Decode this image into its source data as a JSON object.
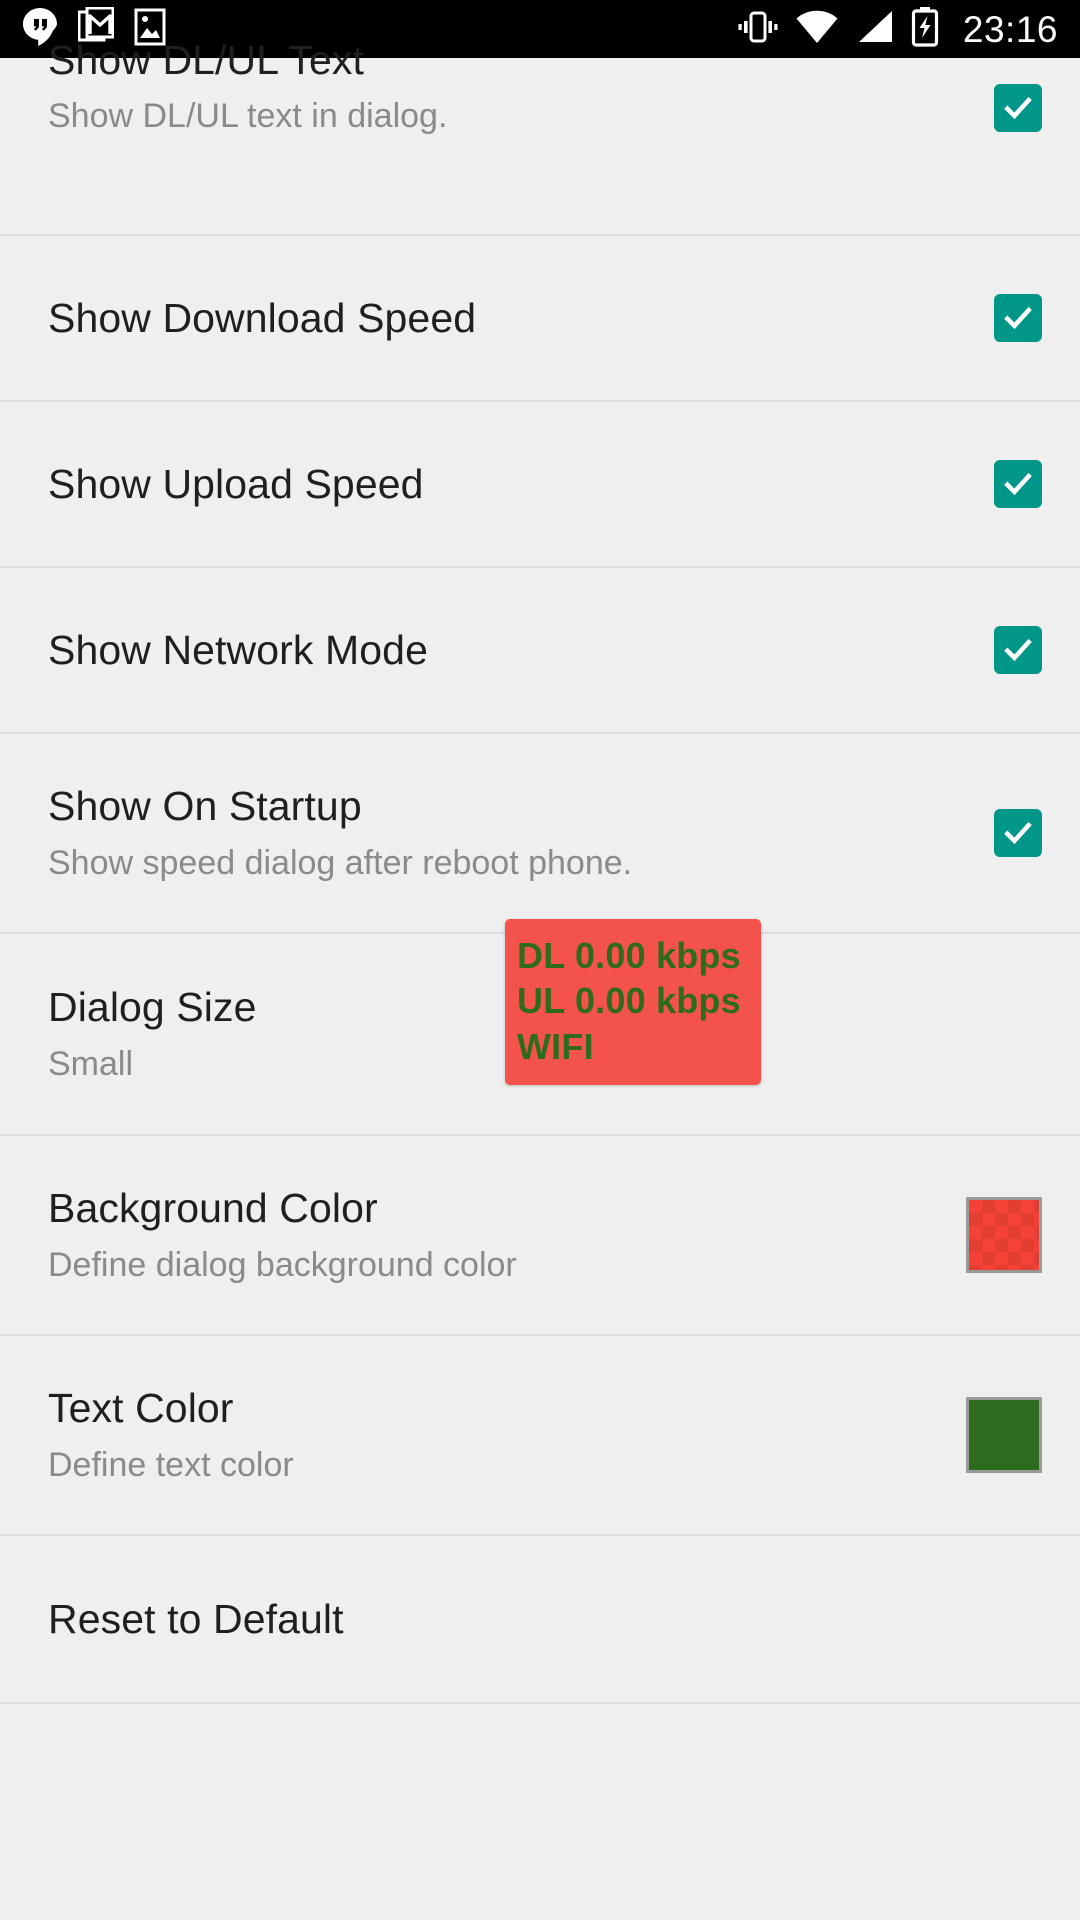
{
  "statusbar": {
    "time": "23:16",
    "left_icons": [
      {
        "name": "hangouts-icon",
        "label": "Hangouts"
      },
      {
        "name": "gmail-icon",
        "label": "Gmail"
      },
      {
        "name": "photo-icon",
        "label": "Screenshot"
      }
    ],
    "right_icons": [
      {
        "name": "vibrate-icon",
        "label": "Vibrate"
      },
      {
        "name": "wifi-icon",
        "label": "Wi-Fi"
      },
      {
        "name": "signal-icon",
        "label": "Cellular signal"
      },
      {
        "name": "battery-charging-icon",
        "label": "Battery charging"
      }
    ]
  },
  "colors": {
    "accent_teal": "#009688",
    "background": "#efefef",
    "divider": "#dcdcdc",
    "title_text": "#1f1f1f",
    "summary_text": "#8a8a8a",
    "statusbar": "#000000",
    "dialog_background": "#f4534c",
    "dialog_text": "#2e6b1e",
    "swatch_border": "#9a9a9a"
  },
  "settings": [
    {
      "id": "show-dl-ul-text",
      "title": "Show DL/UL Text",
      "summary": "Show DL/UL text in dialog.",
      "control": "checkbox",
      "checked": true
    },
    {
      "id": "show-download-speed",
      "title": "Show Download Speed",
      "summary": "",
      "control": "checkbox",
      "checked": true
    },
    {
      "id": "show-upload-speed",
      "title": "Show Upload Speed",
      "summary": "",
      "control": "checkbox",
      "checked": true
    },
    {
      "id": "show-network-mode",
      "title": "Show Network Mode",
      "summary": "",
      "control": "checkbox",
      "checked": true
    },
    {
      "id": "show-on-startup",
      "title": "Show On Startup",
      "summary": "Show speed dialog after reboot phone.",
      "control": "checkbox",
      "checked": true
    },
    {
      "id": "dialog-size",
      "title": "Dialog Size",
      "summary": "Small",
      "control": "none"
    },
    {
      "id": "background-color",
      "title": "Background Color",
      "summary": "Define dialog background color",
      "control": "swatch",
      "swatch_color": "#f44336",
      "swatch_style": "checkerboard"
    },
    {
      "id": "text-color",
      "title": "Text Color",
      "summary": "Define text color",
      "control": "swatch",
      "swatch_color": "#2d6b1f",
      "swatch_style": "solid"
    },
    {
      "id": "reset-to-default",
      "title": "Reset to Default",
      "summary": "",
      "control": "none"
    }
  ],
  "dialog_preview": {
    "download_line": "DL 0.00 kbps",
    "upload_line": "UL 0.00 kbps",
    "network_line": "WIFI"
  }
}
